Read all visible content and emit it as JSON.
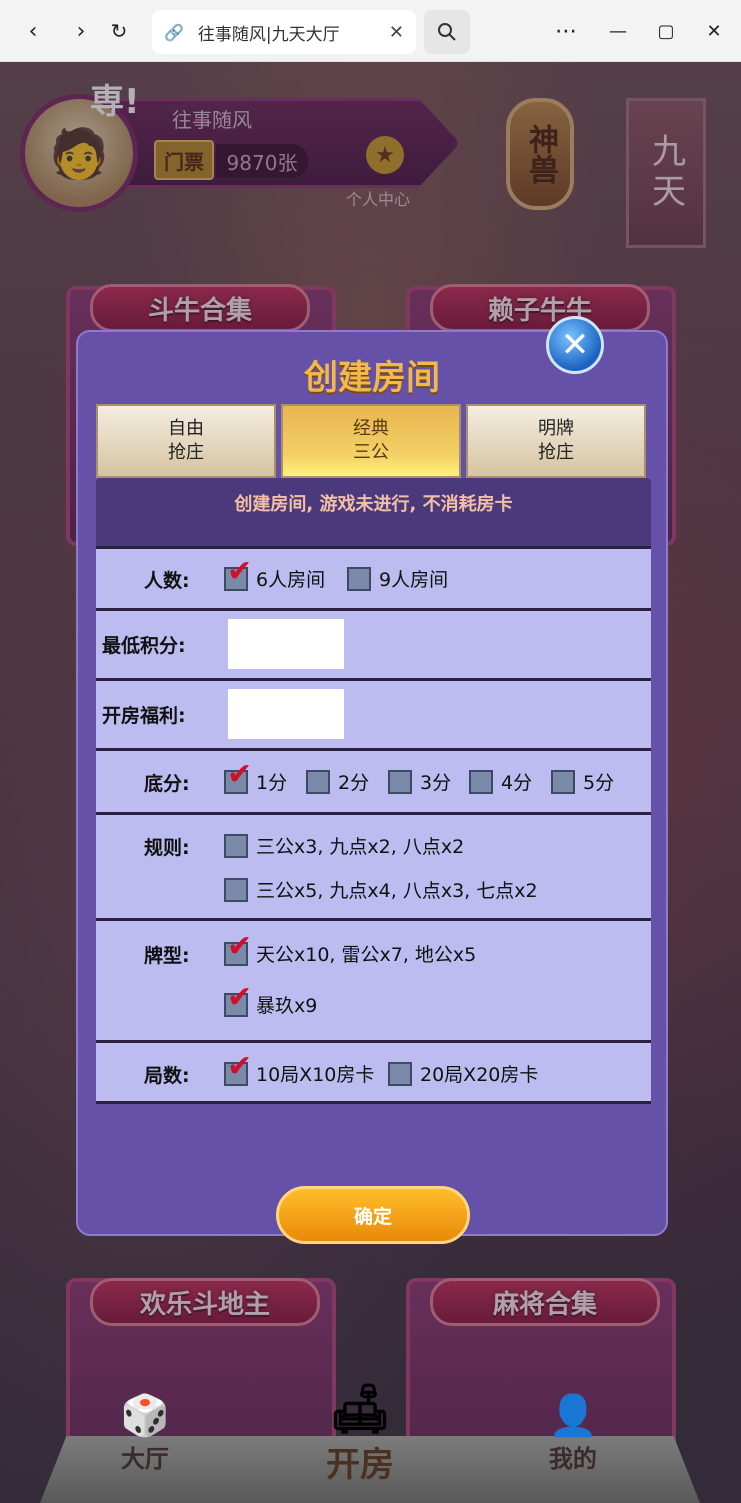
{
  "browser": {
    "tab_title": "往事随风|九天大厅"
  },
  "hud": {
    "marquee": "専!",
    "username": "往事随风",
    "ticket_label": "门票",
    "ticket_value": "9870张",
    "personal_center": "个人中心",
    "shenshou": "神兽",
    "jiutian": "九天"
  },
  "games": {
    "top_left": "斗牛合集",
    "top_right": "赖子牛牛",
    "bottom_left": "欢乐斗地主",
    "bottom_right": "麻将合集"
  },
  "bottom_nav": {
    "hall": "大厅",
    "create": "开房",
    "mine": "我的"
  },
  "modal": {
    "title": "创建房间",
    "tabs": [
      {
        "line1": "自由",
        "line2": "抢庄",
        "active": false
      },
      {
        "line1": "经典",
        "line2": "三公",
        "active": true
      },
      {
        "line1": "明牌",
        "line2": "抢庄",
        "active": false
      }
    ],
    "notice": "创建房间, 游戏未进行, 不消耗房卡",
    "players": {
      "label": "人数:",
      "options": [
        {
          "text": "6人房间",
          "checked": true
        },
        {
          "text": "9人房间",
          "checked": false
        }
      ]
    },
    "min_score": {
      "label": "最低积分:",
      "value": ""
    },
    "welfare": {
      "label": "开房福利:",
      "value": ""
    },
    "base": {
      "label": "底分:",
      "options": [
        {
          "text": "1分",
          "checked": true
        },
        {
          "text": "2分",
          "checked": false
        },
        {
          "text": "3分",
          "checked": false
        },
        {
          "text": "4分",
          "checked": false
        },
        {
          "text": "5分",
          "checked": false
        }
      ]
    },
    "rules": {
      "label": "规则:",
      "options": [
        {
          "text": "三公x3, 九点x2, 八点x2",
          "checked": false
        },
        {
          "text": "三公x5, 九点x4, 八点x3, 七点x2",
          "checked": false
        }
      ]
    },
    "card_types": {
      "label": "牌型:",
      "options": [
        {
          "text": "天公x10, 雷公x7, 地公x5",
          "checked": true
        },
        {
          "text": "暴玖x9",
          "checked": true
        }
      ]
    },
    "rounds": {
      "label": "局数:",
      "options": [
        {
          "text": "10局X10房卡",
          "checked": true
        },
        {
          "text": "20局X20房卡",
          "checked": false
        }
      ]
    },
    "confirm": "确定"
  }
}
